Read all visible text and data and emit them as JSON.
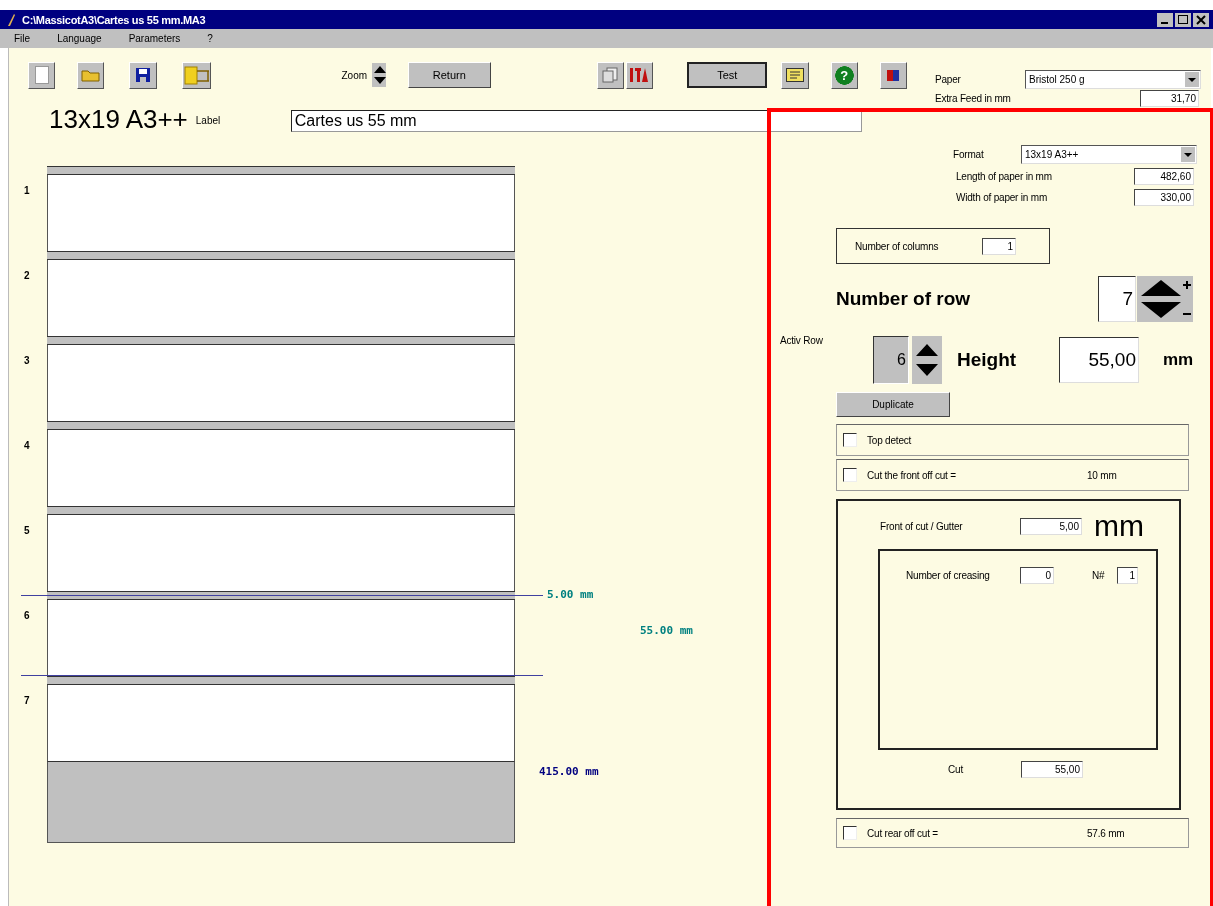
{
  "window": {
    "title": "C:\\MassicotA3\\Cartes us 55 mm.MA3"
  },
  "menu": [
    {
      "label": "File"
    },
    {
      "label": "Language"
    },
    {
      "label": "Parameters"
    },
    {
      "label": "?"
    }
  ],
  "toolbar": {
    "zoom_label": "Zoom",
    "return_button": "Return",
    "test_button": "Test",
    "help_glyph": "?",
    "paper_label": "Paper",
    "paper_value": "Bristol 250 g",
    "extra_feed_label": "Extra Feed  in mm",
    "extra_feed_value": "31,70"
  },
  "header": {
    "format_name": "13x19 A3++",
    "label_caption": "Label",
    "label_value": "Cartes us 55 mm"
  },
  "diagram": {
    "rows": [
      {
        "number": "1",
        "active": false
      },
      {
        "number": "2",
        "active": false
      },
      {
        "number": "3",
        "active": false
      },
      {
        "number": "4",
        "active": false
      },
      {
        "number": "5",
        "active": false
      },
      {
        "number": "6",
        "active": true
      },
      {
        "number": "7",
        "active": false
      }
    ],
    "gutter_reading": "5.00 mm",
    "height_reading": "55.00 mm",
    "total_reading": "415.00 mm"
  },
  "settings": {
    "format_label": "Format",
    "format_value": "13x19 A3++",
    "length_label": "Length of paper in mm",
    "length_value": "482,60",
    "width_label": "Width of paper in mm",
    "width_value": "330,00",
    "columns_label": "Number of columns",
    "columns_value": "1",
    "rows_label": "Number of row",
    "rows_value": "7",
    "active_row_label": "Activ Row",
    "active_row_value": "6",
    "height_label": "Height",
    "height_value": "55,00",
    "height_unit": "mm",
    "duplicate_button": "Duplicate",
    "options": [
      {
        "label": "Top detect",
        "checked": false
      },
      {
        "label": "Cut the front off cut  =",
        "checked": false,
        "reading": "10 mm"
      }
    ],
    "gutter_label": "Front of cut / Gutter",
    "gutter_value": "5,00",
    "gutter_unit": "mm",
    "creasing_label": "Number of creasing",
    "creasing_value": "0",
    "n_label": "N#",
    "n_value": "1",
    "cut_label": "Cut",
    "cut_value": "55,00",
    "rear": {
      "label": "Cut rear off cut  =",
      "checked": false,
      "reading": "57.6 mm"
    }
  }
}
